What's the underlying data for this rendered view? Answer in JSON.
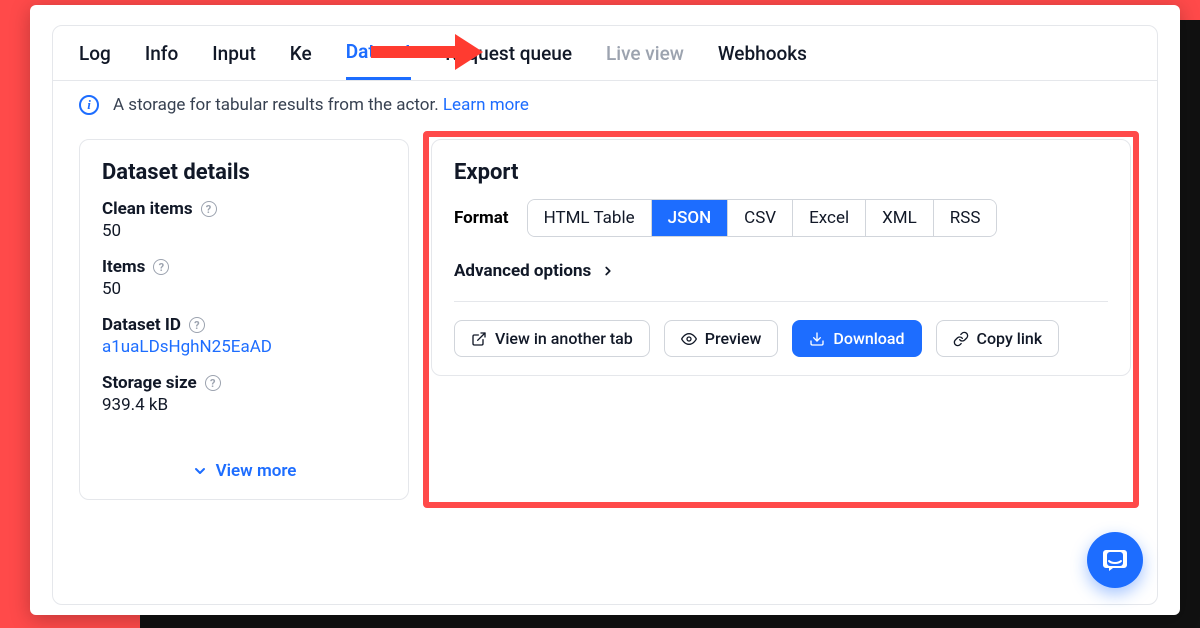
{
  "tabs": {
    "log": "Log",
    "info": "Info",
    "input": "Input",
    "key": "Ke",
    "dataset": "Dataset",
    "request_queue": "Request queue",
    "live_view": "Live view",
    "webhooks": "Webhooks"
  },
  "info_bar": {
    "text": "A storage for tabular results from the actor.",
    "link": "Learn more"
  },
  "details": {
    "title": "Dataset details",
    "clean_items_label": "Clean items",
    "clean_items_value": "50",
    "items_label": "Items",
    "items_value": "50",
    "dataset_id_label": "Dataset ID",
    "dataset_id_value": "a1uaLDsHghN25EaAD",
    "storage_label": "Storage size",
    "storage_value": "939.4 kB",
    "view_more": "View more"
  },
  "export": {
    "title": "Export",
    "format_label": "Format",
    "formats": {
      "html": "HTML Table",
      "json": "JSON",
      "csv": "CSV",
      "excel": "Excel",
      "xml": "XML",
      "rss": "RSS"
    },
    "advanced": "Advanced options",
    "actions": {
      "view_tab": "View in another tab",
      "preview": "Preview",
      "download": "Download",
      "copy": "Copy link"
    }
  }
}
